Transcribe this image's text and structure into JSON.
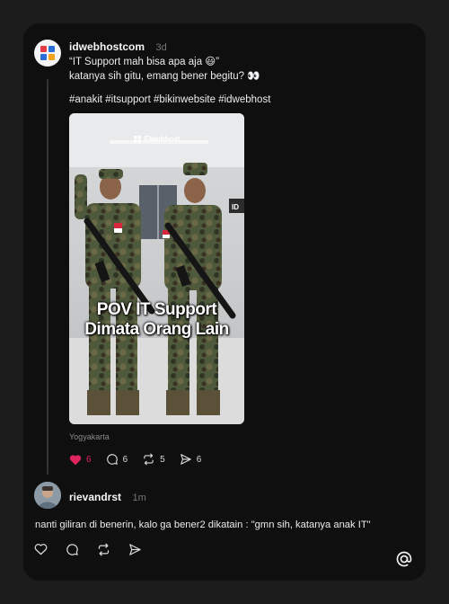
{
  "post": {
    "username": "idwebhostcom",
    "time": "3d",
    "caption_line1": "“IT Support mah bisa apa aja 😃”",
    "caption_line2": "katanya sih gitu, emang bener begitu? 👀",
    "hashtags": "#anakit #itsupport #bikinwebsite #idwebhost",
    "media": {
      "watermark": "IDwebhost",
      "overlay_line1": "POV IT Support",
      "overlay_line2": "Dimata Orang Lain",
      "wall_sign": "ID"
    },
    "location": "Yogyakarta",
    "likes": "6",
    "replies": "6",
    "reposts": "5",
    "shares": "6",
    "like_color": "#e0245e"
  },
  "reply": {
    "username": "rievandrst",
    "time": "1m",
    "text": "nanti giliran di benerin, kalo ga bener2 dikatain : \"gmn sih, katanya anak IT\""
  },
  "icons": {
    "like": "heart-icon",
    "reply": "comment-icon",
    "repost": "repost-icon",
    "share": "send-icon",
    "app": "threads-logo-icon"
  }
}
